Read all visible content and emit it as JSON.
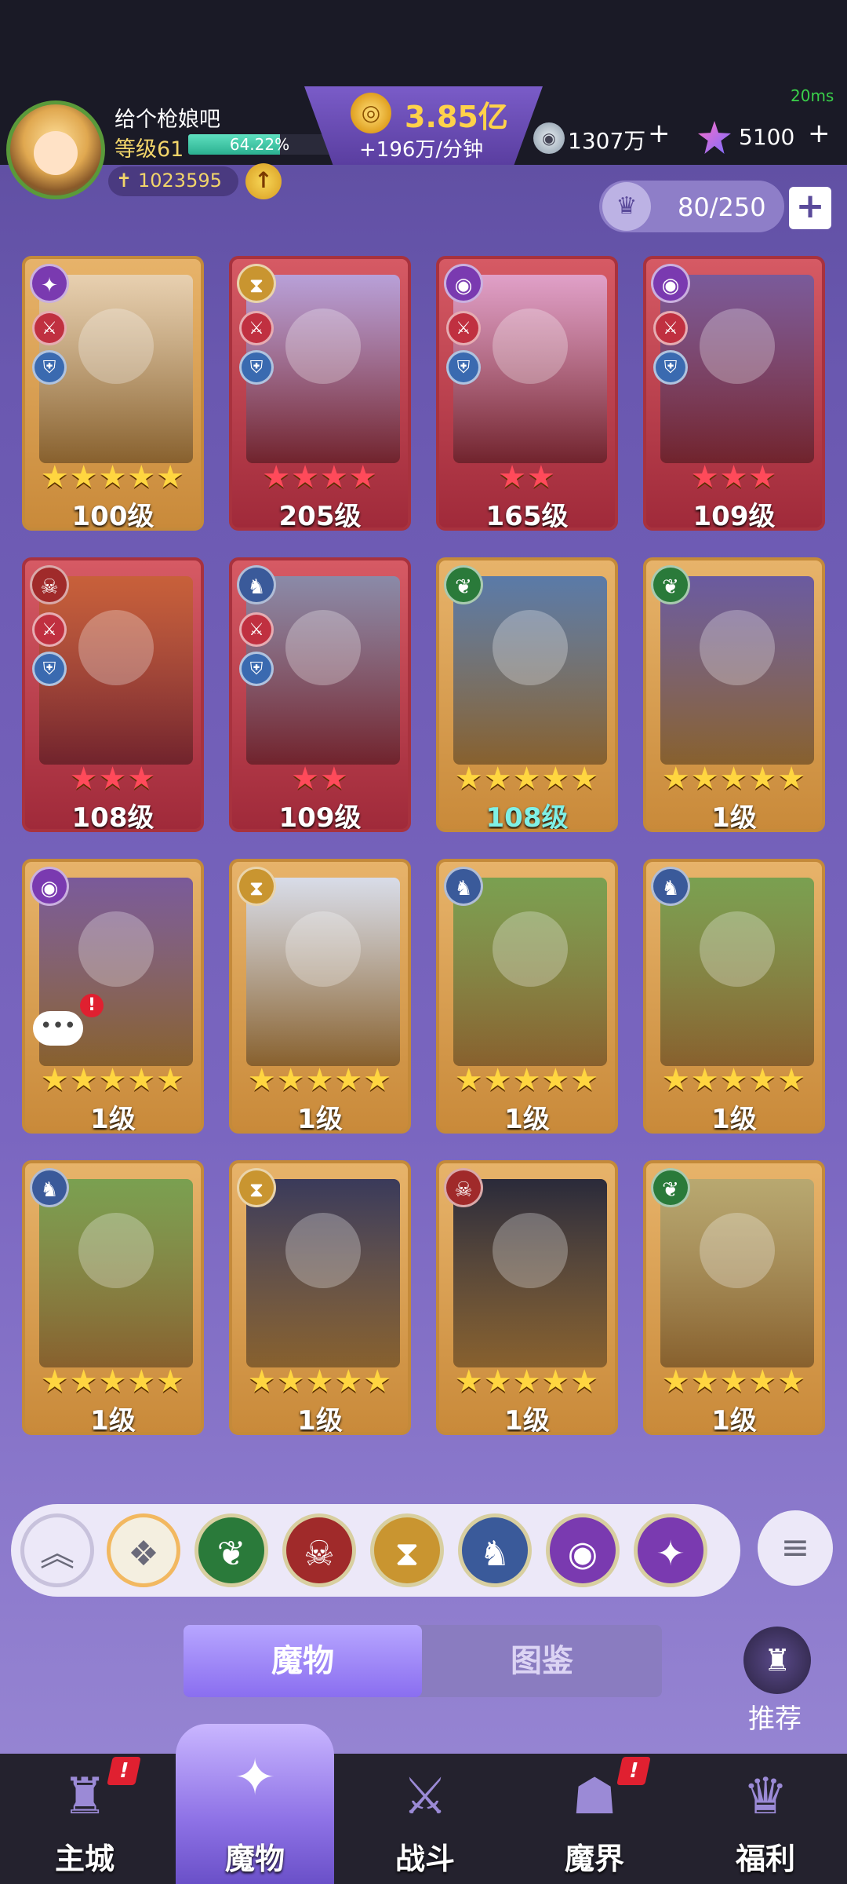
{
  "header": {
    "player_name": "给个枪娘吧",
    "level_label": "等级61",
    "exp_percent_text": "64.22%",
    "exp_fraction": 0.6422,
    "power": "1023595",
    "upgrade_icon": "arrow-up-icon",
    "gold": "3.85亿",
    "gold_rate": "+196万/分钟",
    "ping": "20ms",
    "silver": "1307万",
    "gems": "5100"
  },
  "capacity": {
    "value": "80/250",
    "add_label": "+"
  },
  "cards": [
    {
      "stars": "★★★★★",
      "level": "100级",
      "frame": "gold",
      "element": "wind",
      "roles": true,
      "art_color": "#e8d0b0"
    },
    {
      "stars": "★★★★",
      "level": "205级",
      "frame": "red",
      "element": "time",
      "roles": true,
      "art_color": "#b8a0d8"
    },
    {
      "stars": "★★",
      "level": "165级",
      "frame": "red",
      "element": "eye",
      "roles": true,
      "art_color": "#e0a0c8"
    },
    {
      "stars": "★★★",
      "level": "109级",
      "frame": "red",
      "element": "eye",
      "roles": true,
      "art_color": "#7a5a9a"
    },
    {
      "stars": "★★★",
      "level": "108级",
      "frame": "red",
      "element": "fire",
      "roles": true,
      "art_color": "#c8603a"
    },
    {
      "stars": "★★",
      "level": "109级",
      "frame": "red",
      "element": "dragon",
      "roles": true,
      "art_color": "#8a8aa8"
    },
    {
      "stars": "★★★★★",
      "level": "108级",
      "frame": "gold",
      "element": "nature",
      "roles": false,
      "art_color": "#5a7aa8",
      "level_cyan": true
    },
    {
      "stars": "★★★★★",
      "level": "1级",
      "frame": "gold",
      "element": "nature",
      "roles": false,
      "art_color": "#6a5aa0"
    },
    {
      "stars": "★★★★★",
      "level": "1级",
      "frame": "gold",
      "element": "eye",
      "roles": false,
      "art_color": "#7a5a9a",
      "alert": "!",
      "chat": "•••"
    },
    {
      "stars": "★★★★★",
      "level": "1级",
      "frame": "gold",
      "element": "time",
      "roles": false,
      "art_color": "#d8dce8"
    },
    {
      "stars": "★★★★★",
      "level": "1级",
      "frame": "gold",
      "element": "dragon",
      "roles": false,
      "art_color": "#7aa050"
    },
    {
      "stars": "★★★★★",
      "level": "1级",
      "frame": "gold",
      "element": "dragon",
      "roles": false,
      "art_color": "#7aa050"
    },
    {
      "stars": "★★★★★",
      "level": "1级",
      "frame": "gold",
      "element": "dragon",
      "roles": false,
      "art_color": "#7aa050"
    },
    {
      "stars": "★★★★★",
      "level": "1级",
      "frame": "gold",
      "element": "time",
      "roles": false,
      "art_color": "#3a3a5a"
    },
    {
      "stars": "★★★★★",
      "level": "1级",
      "frame": "gold",
      "element": "fire",
      "roles": false,
      "art_color": "#2a2a3a"
    },
    {
      "stars": "★★★★★",
      "level": "1级",
      "frame": "gold",
      "element": "nature",
      "roles": false,
      "art_color": "#b8a870"
    }
  ],
  "element_colors": {
    "wind": "#7a3ab0",
    "time": "#c99530",
    "eye": "#7a3ab0",
    "fire": "#a02a2a",
    "dragon": "#3a5a9a",
    "nature": "#2a7a3a"
  },
  "element_icons": {
    "wind": "✦",
    "time": "⧗",
    "eye": "◉",
    "fire": "☠",
    "dragon": "♞",
    "nature": "❦"
  },
  "filters": [
    {
      "name": "collapse",
      "icon": "︽",
      "color": "#ece8f8"
    },
    {
      "name": "all",
      "icon": "❖",
      "color": "#f4efe0"
    },
    {
      "name": "nature",
      "icon": "❦",
      "color": "#2a7a3a"
    },
    {
      "name": "fire",
      "icon": "☠",
      "color": "#a02a2a"
    },
    {
      "name": "time",
      "icon": "⧗",
      "color": "#c99530"
    },
    {
      "name": "dragon",
      "icon": "♞",
      "color": "#3a5a9a"
    },
    {
      "name": "eye",
      "icon": "◉",
      "color": "#7a3ab0"
    },
    {
      "name": "wind",
      "icon": "✦",
      "color": "#7a3ab0"
    }
  ],
  "sort_icon": "≡",
  "tabs": {
    "active": "魔物",
    "inactive": "图鉴"
  },
  "recommend": {
    "label": "推荐",
    "icon": "♜"
  },
  "nav": [
    {
      "label": "主城",
      "icon": "♜",
      "badge": "!"
    },
    {
      "label": "魔物",
      "icon": "✦",
      "active": true
    },
    {
      "label": "战斗",
      "icon": "⚔"
    },
    {
      "label": "魔界",
      "icon": "☗",
      "badge": "!"
    },
    {
      "label": "福利",
      "icon": "♛"
    }
  ]
}
